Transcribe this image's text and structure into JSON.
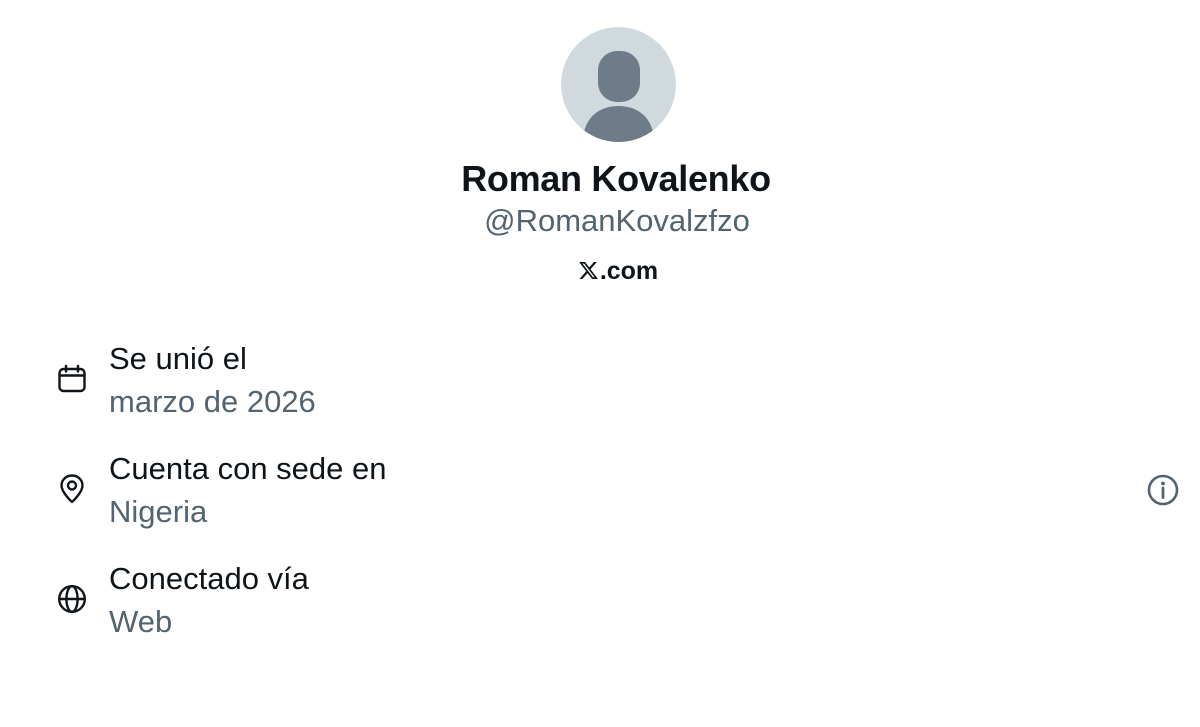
{
  "profile": {
    "avatar_icon": "default-avatar-icon",
    "display_name": "Roman Kovalenko",
    "handle": "@RomanKovalzfzo",
    "verified_via": {
      "logo_icon": "x-logo-icon",
      "domain_suffix": ".com"
    }
  },
  "about": {
    "joined": {
      "icon": "calendar-icon",
      "label": "Se unió el",
      "value": "marzo de 2026"
    },
    "based_in": {
      "icon": "location-pin-icon",
      "label": "Cuenta con sede en",
      "value": "Nigeria",
      "info_icon": "info-icon"
    },
    "connected_via": {
      "icon": "globe-icon",
      "label": "Conectado vía",
      "value": "Web"
    }
  },
  "colors": {
    "primary_text": "#0f1419",
    "secondary_text": "#536471",
    "avatar_bg": "#cfd9de",
    "avatar_figure": "#6e7b88"
  }
}
